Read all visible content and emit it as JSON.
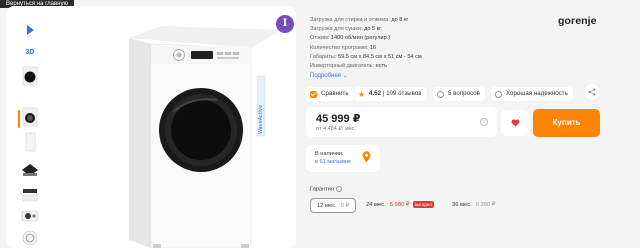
{
  "tooltip": {
    "back": "Вернуться на главную"
  },
  "gallery": {
    "thumbs": [
      "play-icon",
      "3D",
      "front-view",
      "front-open-door",
      "side-view",
      "drum-view",
      "top-view",
      "control-panel-view",
      "back-view"
    ],
    "label_3d": "3D",
    "active_index": 3
  },
  "brand": {
    "badge_letter": "I",
    "badge_color": "#7a4bbf",
    "logo": "gorenje"
  },
  "specs": [
    {
      "key": "Загрузка для стирки и отжима:",
      "value": "до 8 кг"
    },
    {
      "key": "Загрузка для сушки:",
      "value": "до 5 кг"
    },
    {
      "key": "Отжим:",
      "value": "1400 об/мин (регулир.)"
    },
    {
      "key": "Количество программ:",
      "value": "16"
    },
    {
      "key": "Габариты:",
      "value": "59.5 см x 84.5 см x 51 см - 54 см"
    },
    {
      "key": "Инверторный двигатель:",
      "value": "есть"
    }
  ],
  "more_link": "Подробнее ⌄",
  "actions": {
    "compare": "Сравнить",
    "rating": "4.52",
    "reviews": "| 109 отзывов",
    "questions": "5 вопросов",
    "reliability": "Хорошая надежность"
  },
  "price": {
    "value": "45 999 ₽",
    "credit": "от 4 484 ₽/ мес."
  },
  "buy_label": "Купить",
  "stock": {
    "line1": "В наличии",
    "line2": "в 61 магазине"
  },
  "warranty": {
    "title": "Гарантия",
    "options": [
      {
        "term": "12 мес.",
        "price": "0 ₽",
        "badge": ""
      },
      {
        "term": "24 мес.",
        "price": "5 980 ₽",
        "badge": "выгодно"
      },
      {
        "term": "36 мес.",
        "price": "8 280 ₽",
        "badge": ""
      }
    ]
  },
  "colors": {
    "accent": "#fc8507",
    "link": "#3d6fe0",
    "sale": "#e53935"
  }
}
